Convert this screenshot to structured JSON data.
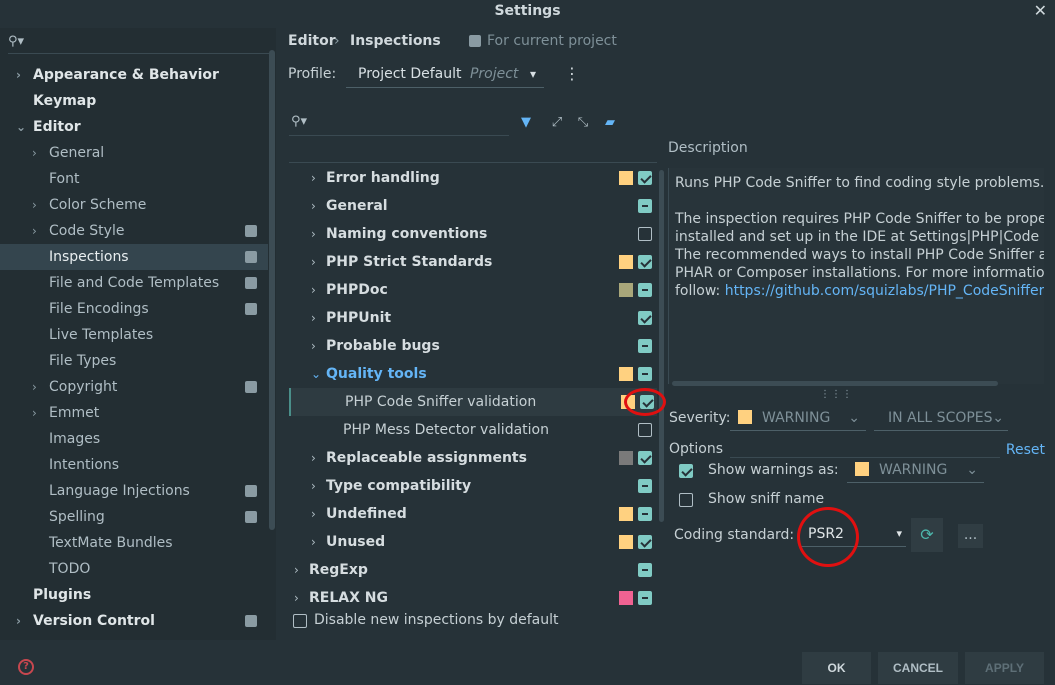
{
  "window": {
    "title": "Settings"
  },
  "sidebar": {
    "items": [
      {
        "label": "Appearance & Behavior",
        "level": 0,
        "bold": true,
        "arrow": "›",
        "badge": false
      },
      {
        "label": "Keymap",
        "level": 0,
        "bold": true,
        "arrow": "",
        "badge": false
      },
      {
        "label": "Editor",
        "level": 0,
        "bold": true,
        "arrow": "⌄",
        "badge": false
      },
      {
        "label": "General",
        "level": 1,
        "bold": false,
        "arrow": "›",
        "badge": false
      },
      {
        "label": "Font",
        "level": 1,
        "bold": false,
        "arrow": "",
        "badge": false
      },
      {
        "label": "Color Scheme",
        "level": 1,
        "bold": false,
        "arrow": "›",
        "badge": false
      },
      {
        "label": "Code Style",
        "level": 1,
        "bold": false,
        "arrow": "›",
        "badge": true
      },
      {
        "label": "Inspections",
        "level": 1,
        "bold": false,
        "arrow": "",
        "badge": true,
        "selected": true
      },
      {
        "label": "File and Code Templates",
        "level": 1,
        "bold": false,
        "arrow": "",
        "badge": true
      },
      {
        "label": "File Encodings",
        "level": 1,
        "bold": false,
        "arrow": "",
        "badge": true
      },
      {
        "label": "Live Templates",
        "level": 1,
        "bold": false,
        "arrow": "",
        "badge": false
      },
      {
        "label": "File Types",
        "level": 1,
        "bold": false,
        "arrow": "",
        "badge": false
      },
      {
        "label": "Copyright",
        "level": 1,
        "bold": false,
        "arrow": "›",
        "badge": true
      },
      {
        "label": "Emmet",
        "level": 1,
        "bold": false,
        "arrow": "›",
        "badge": false
      },
      {
        "label": "Images",
        "level": 1,
        "bold": false,
        "arrow": "",
        "badge": false
      },
      {
        "label": "Intentions",
        "level": 1,
        "bold": false,
        "arrow": "",
        "badge": false
      },
      {
        "label": "Language Injections",
        "level": 1,
        "bold": false,
        "arrow": "",
        "badge": true
      },
      {
        "label": "Spelling",
        "level": 1,
        "bold": false,
        "arrow": "",
        "badge": true
      },
      {
        "label": "TextMate Bundles",
        "level": 1,
        "bold": false,
        "arrow": "",
        "badge": false
      },
      {
        "label": "TODO",
        "level": 1,
        "bold": false,
        "arrow": "",
        "badge": false
      },
      {
        "label": "Plugins",
        "level": 0,
        "bold": true,
        "arrow": "",
        "badge": false
      },
      {
        "label": "Version Control",
        "level": 0,
        "bold": true,
        "arrow": "›",
        "badge": true
      }
    ]
  },
  "breadcrumb": {
    "parent": "Editor",
    "sep": "›",
    "current": "Inspections",
    "scope_note": "For current project"
  },
  "profile": {
    "label": "Profile:",
    "value": "Project Default",
    "kind": "Project",
    "caret": "▾",
    "menu": "⋮"
  },
  "tree": {
    "rows": [
      {
        "label": "Error handling",
        "indent": 1,
        "style": "bold",
        "arrow": "›",
        "severity": "#ffd180",
        "check": "on"
      },
      {
        "label": "General",
        "indent": 1,
        "style": "bold",
        "arrow": "›",
        "severity": "",
        "check": "mixed"
      },
      {
        "label": "Naming conventions",
        "indent": 1,
        "style": "bold",
        "arrow": "›",
        "severity": "",
        "check": "off"
      },
      {
        "label": "PHP Strict Standards",
        "indent": 1,
        "style": "bold",
        "arrow": "›",
        "severity": "#ffd180",
        "check": "on"
      },
      {
        "label": "PHPDoc",
        "indent": 1,
        "style": "bold",
        "arrow": "›",
        "severity": "#a9a77a",
        "check": "mixed"
      },
      {
        "label": "PHPUnit",
        "indent": 1,
        "style": "bold",
        "arrow": "›",
        "severity": "",
        "check": "on"
      },
      {
        "label": "Probable bugs",
        "indent": 1,
        "style": "bold",
        "arrow": "›",
        "severity": "",
        "check": "mixed"
      },
      {
        "label": "Quality tools",
        "indent": 1,
        "style": "blue",
        "arrow": "⌄",
        "severity": "#ffd180",
        "check": "mixed"
      },
      {
        "label": "PHP Code Sniffer validation",
        "indent": 2,
        "style": "plain",
        "arrow": "",
        "severity": "#ffd180",
        "check": "on",
        "selected": true
      },
      {
        "label": "PHP Mess Detector validation",
        "indent": 2,
        "style": "plain",
        "arrow": "",
        "severity": "",
        "check": "off"
      },
      {
        "label": "Replaceable assignments",
        "indent": 1,
        "style": "bold",
        "arrow": "›",
        "severity": "#7a7a7a",
        "check": "on"
      },
      {
        "label": "Type compatibility",
        "indent": 1,
        "style": "bold",
        "arrow": "›",
        "severity": "",
        "check": "mixed"
      },
      {
        "label": "Undefined",
        "indent": 1,
        "style": "bold",
        "arrow": "›",
        "severity": "#ffd180",
        "check": "mixed"
      },
      {
        "label": "Unused",
        "indent": 1,
        "style": "bold",
        "arrow": "›",
        "severity": "#ffd180",
        "check": "on"
      },
      {
        "label": "RegExp",
        "indent": 0,
        "style": "bold",
        "arrow": "›",
        "severity": "",
        "check": "mixed"
      },
      {
        "label": "RELAX NG",
        "indent": 0,
        "style": "bold",
        "arrow": "›",
        "severity": "#f06292",
        "check": "mixed"
      }
    ],
    "disable_new": "Disable new inspections by default"
  },
  "description": {
    "heading": "Description",
    "line1": "Runs PHP Code Sniffer to find coding style problems.",
    "line2": "The inspection requires PHP Code Sniffer to be properly",
    "line3": "installed and set up in the IDE at Settings|PHP|Code Sni",
    "line4": "The recommended ways to install PHP Code Sniffer are",
    "line5": "PHAR or Composer installations. For more information",
    "line6_prefix": "follow: ",
    "link": "https://github.com/squizlabs/PHP_CodeSniffer"
  },
  "severity": {
    "label": "Severity:",
    "value": "WARNING",
    "scope": "IN ALL SCOPES",
    "color": "#ffd180"
  },
  "options": {
    "heading": "Options",
    "reset": "Reset",
    "show_warnings_label": "Show warnings as:",
    "show_warnings_value": "WARNING",
    "show_sniff_label": "Show sniff name",
    "coding_standard_label": "Coding standard:",
    "coding_standard_value": "PSR2",
    "more": "..."
  },
  "buttons": {
    "ok": "OK",
    "cancel": "CANCEL",
    "apply": "APPLY"
  }
}
